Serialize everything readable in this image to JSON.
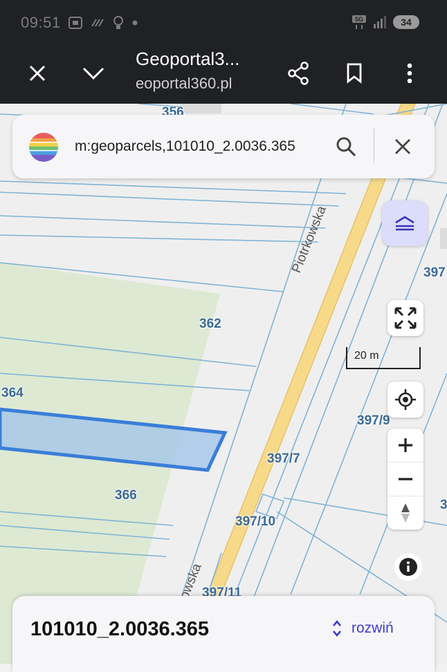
{
  "status_bar": {
    "time": "09:51",
    "battery": "34",
    "network": "5G"
  },
  "toolbar": {
    "title": "Geoportal3...",
    "url": "eoportal360.pl",
    "icons": [
      "close-icon",
      "chevron-down-icon",
      "share-icon",
      "bookmark-icon",
      "more-vert-icon"
    ]
  },
  "search": {
    "query": "m:geoparcels,101010_2.0036.365",
    "icons": [
      "search-icon",
      "close-icon"
    ]
  },
  "map": {
    "parcel_labels": {
      "p356": "356",
      "p362": "362",
      "p364": "364",
      "p366": "366",
      "p397": "397",
      "p397_9": "397/9",
      "p397_7": "397/7",
      "p397_10": "397/10",
      "p397_11": "397/11",
      "p3": "3"
    },
    "streets": {
      "main": "Piotrkowska",
      "lower": "owska"
    },
    "scale": "20 m",
    "colors": {
      "parcel_line": "#7fb3d5",
      "road": "#f7d98a",
      "green_area": "#dde9d3",
      "selected_fill": "#9fc3ea",
      "selected_stroke": "#3a7ed8"
    }
  },
  "bottom_card": {
    "parcel_id": "101010_2.0036.365",
    "expand_label": "rozwiń"
  }
}
